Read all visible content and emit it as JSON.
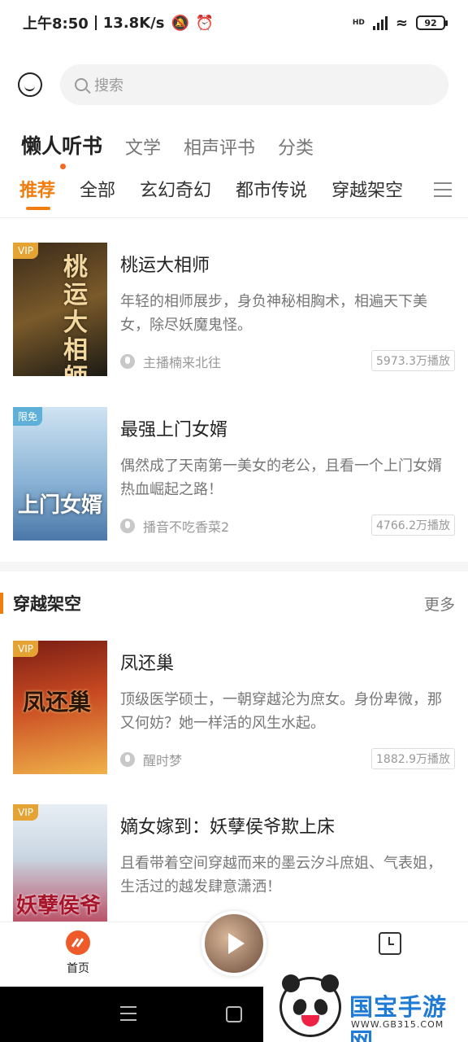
{
  "status_bar": {
    "time": "上午8:50",
    "net_speed": "13.8K/s",
    "hd_label": "HD",
    "battery": "92"
  },
  "search": {
    "placeholder": "搜索"
  },
  "top_tabs": [
    {
      "label": "懒人听书",
      "active": true
    },
    {
      "label": "文学",
      "active": false
    },
    {
      "label": "相声评书",
      "active": false
    },
    {
      "label": "分类",
      "active": false
    }
  ],
  "category_tabs": [
    {
      "label": "推荐",
      "active": true
    },
    {
      "label": "全部",
      "active": false
    },
    {
      "label": "玄幻奇幻",
      "active": false
    },
    {
      "label": "都市传说",
      "active": false
    },
    {
      "label": "穿越架空",
      "active": false
    }
  ],
  "books": [
    {
      "badge": "VIP",
      "title": "桃运大相师",
      "cover_title": "桃运大相師",
      "description": "年轻的相师展步，身负神秘相胸术，相遍天下美女，除尽妖魔鬼怪。",
      "anchor": "主播楠来北往",
      "plays": "5973.3万播放"
    },
    {
      "badge": "限免",
      "title": "最强上门女婿",
      "cover_title": "上门女婿",
      "description": "偶然成了天南第一美女的老公，且看一个上门女婿热血崛起之路！",
      "anchor": "播音不吃香菜2",
      "plays": "4766.2万播放"
    }
  ],
  "section": {
    "title": "穿越架空",
    "more": "更多",
    "books": [
      {
        "badge": "VIP",
        "title": "凤还巢",
        "cover_title": "凤还巢",
        "description": "顶级医学硕士，一朝穿越沦为庶女。身份卑微，那又何妨？她一样活的风生水起。",
        "anchor": "醒时梦",
        "plays": "1882.9万播放"
      },
      {
        "badge": "VIP",
        "title": "嫡女嫁到：妖孽侯爷欺上床",
        "cover_title": "妖孽侯爷",
        "description": "且看带着空间穿越而来的墨云汐斗庶姐、气表姐，生活过的越发肆意潇洒！",
        "anchor": "",
        "plays": ""
      }
    ]
  },
  "bottom_nav": {
    "home_label": "首页"
  },
  "watermark": {
    "title": "国宝手游网",
    "url": "WWW.GB315.COM"
  }
}
